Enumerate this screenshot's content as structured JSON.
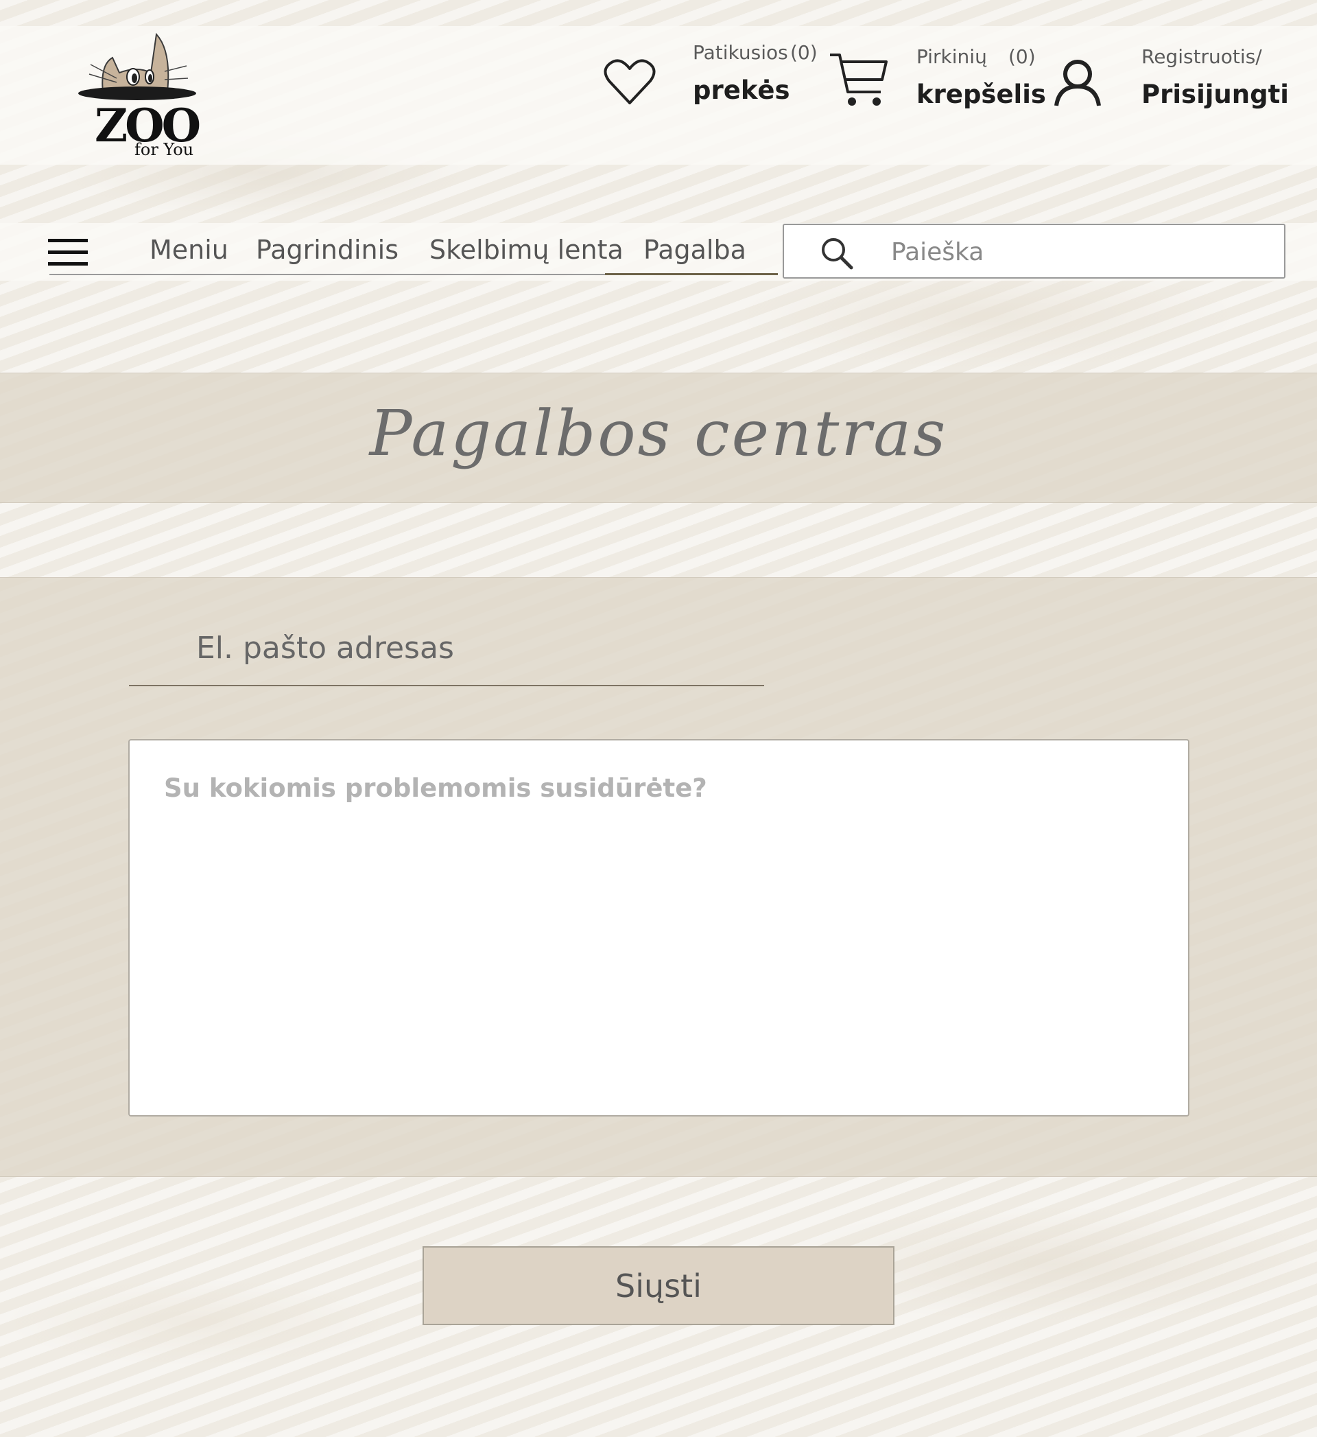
{
  "header": {
    "logo": {
      "text": "ZOO",
      "subtext": "for You"
    },
    "favorites": {
      "label_small": "Patikusios",
      "count": "(0)",
      "label_big": "prekės"
    },
    "cart": {
      "label_small": "Pirkinių",
      "count": "(0)",
      "label_big": "krepšelis"
    },
    "account": {
      "label_small": "Registruotis/",
      "label_big": "Prisijungti"
    }
  },
  "nav": {
    "items": [
      {
        "label": "Meniu"
      },
      {
        "label": "Pagrindinis"
      },
      {
        "label": "Skelbimų lenta"
      },
      {
        "label": "Pagalba"
      }
    ],
    "active": "Pagalba",
    "search_placeholder": "Paieška"
  },
  "page": {
    "title": "Pagalbos centras",
    "email_placeholder": "El. pašto adresas",
    "message_placeholder": "Su kokiomis problemomis susidūrėte?",
    "submit_label": "Siųsti"
  },
  "colors": {
    "accent_beige": "#ddd3c5",
    "logo_cat": "#c8b49c",
    "title_gray": "#6c6c6c"
  },
  "icons": [
    "hamburger-icon",
    "heart-icon",
    "cart-icon",
    "user-icon",
    "search-icon"
  ]
}
